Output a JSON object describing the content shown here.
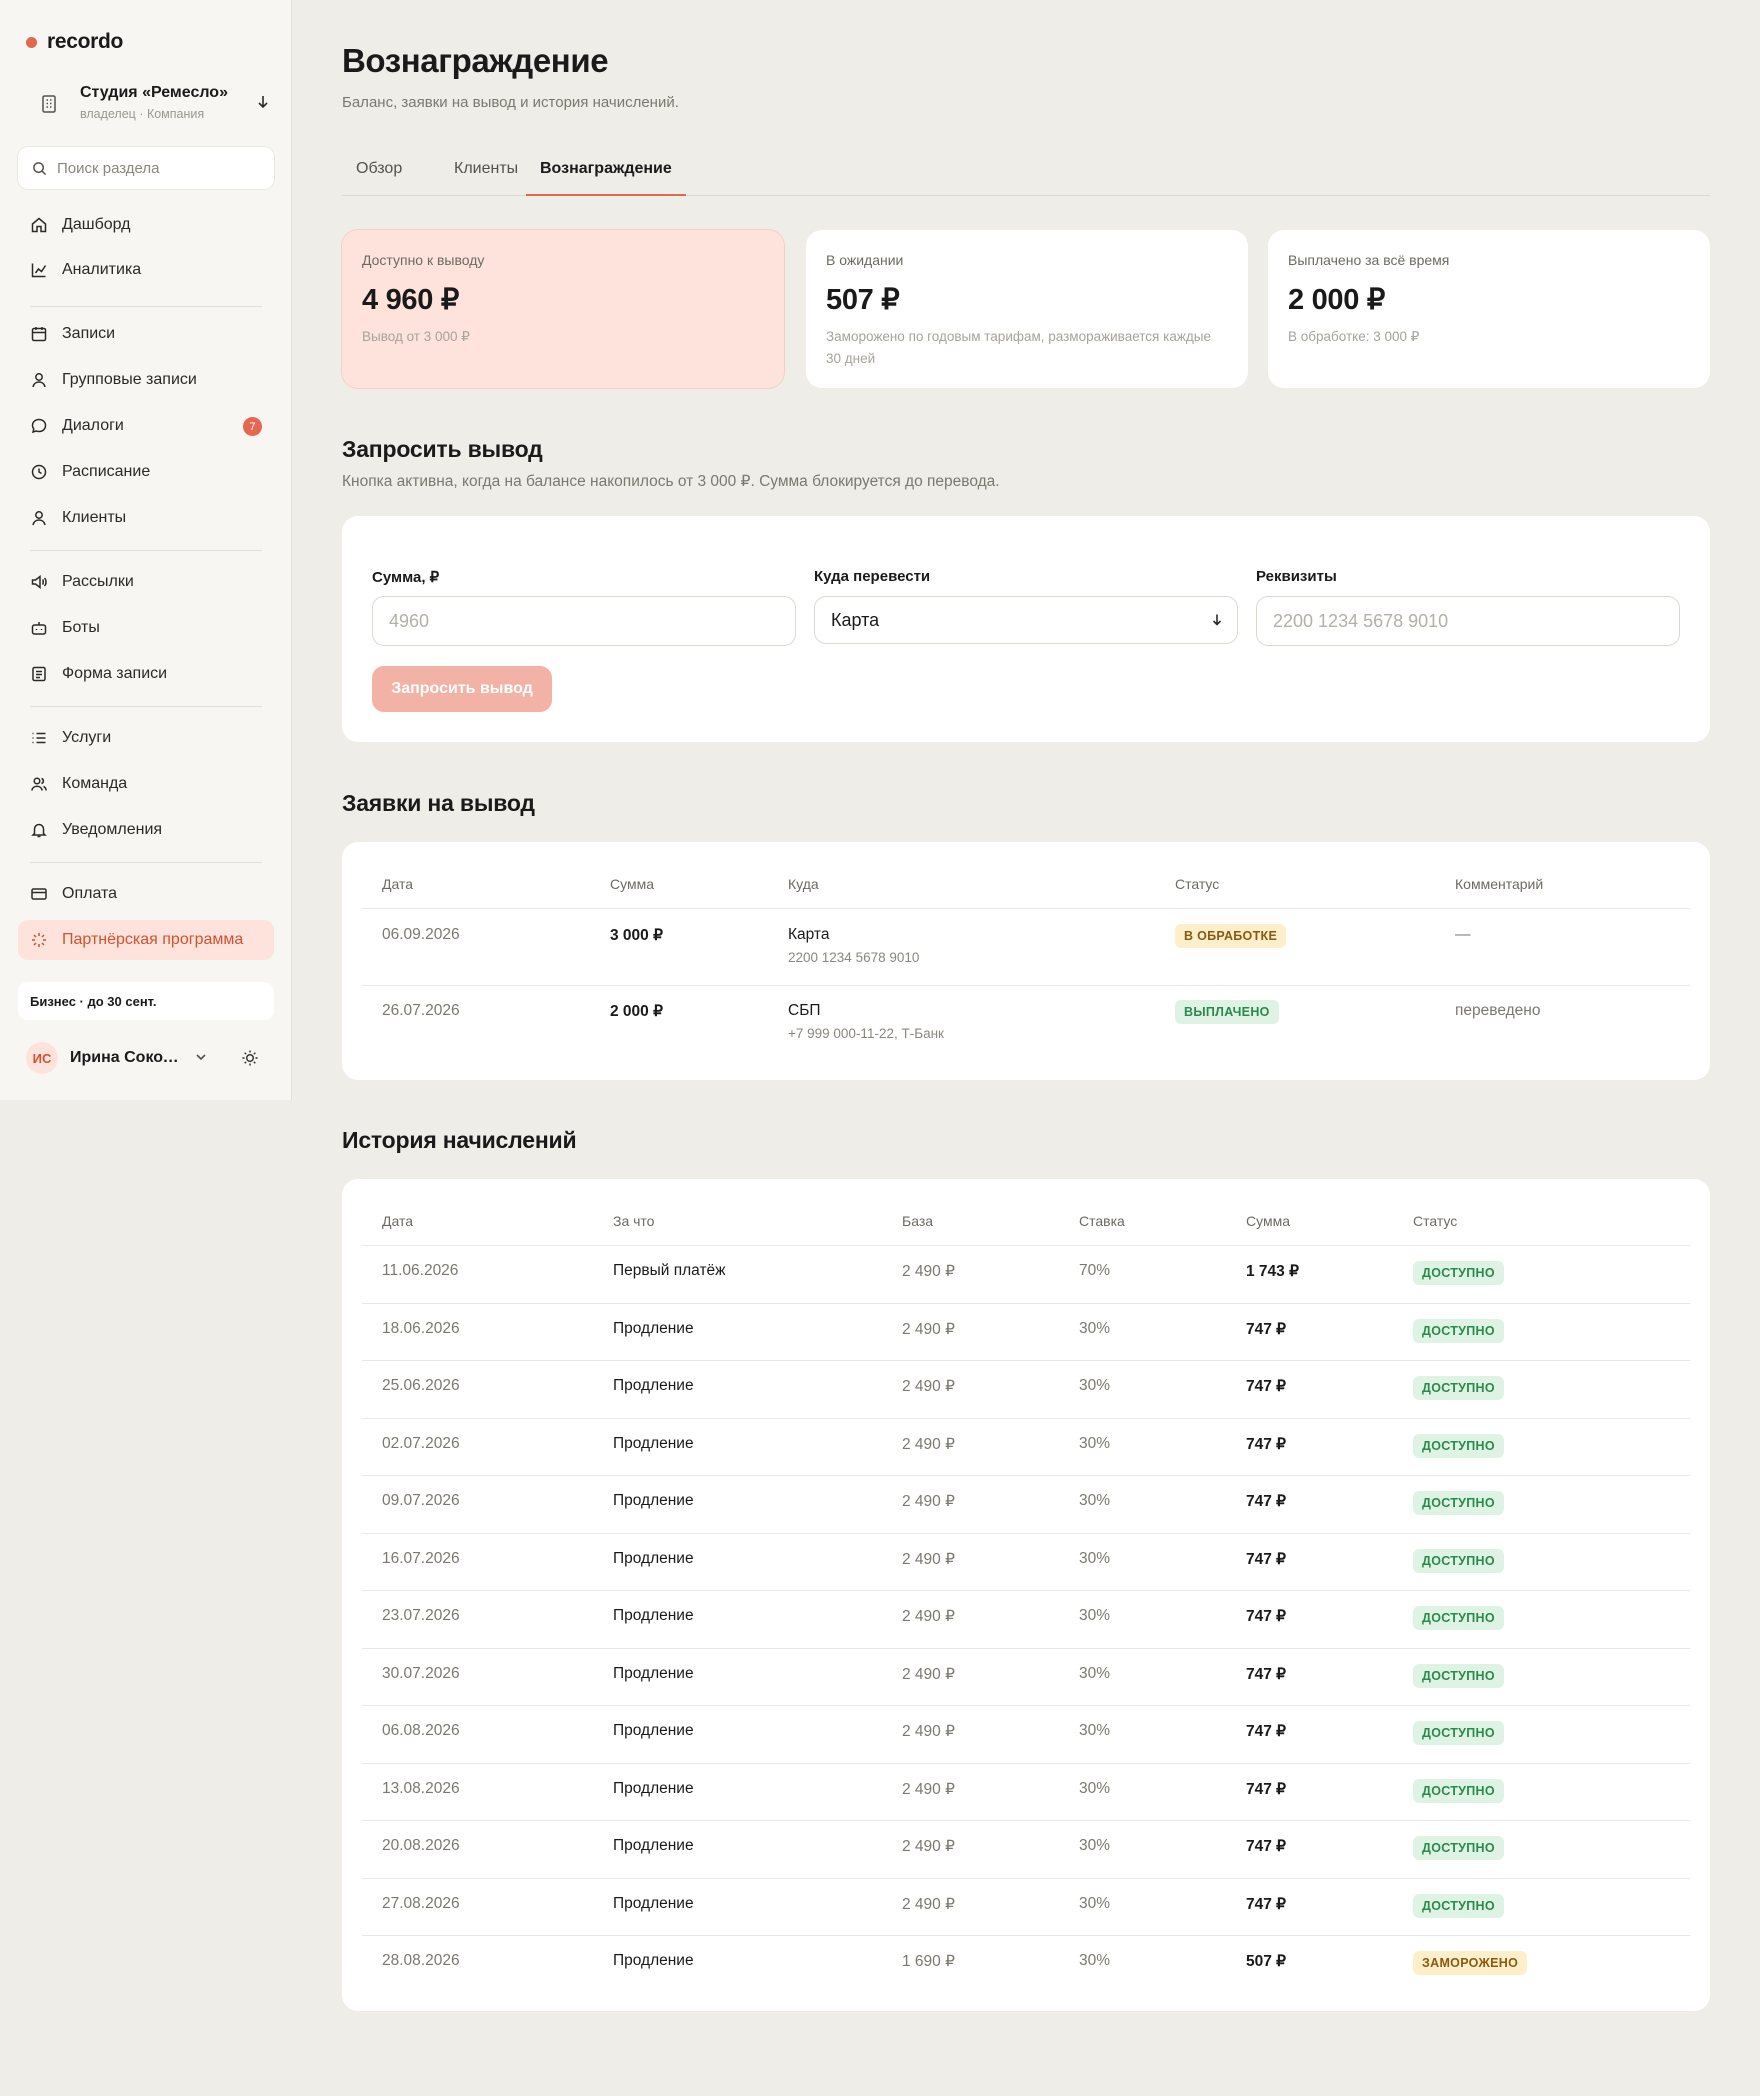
{
  "app": {
    "logo": "recordo",
    "accent": "#e4674f"
  },
  "workspace": {
    "name": "Студия «Ремесло»",
    "role": "владелец · Компания"
  },
  "search": {
    "placeholder": "Поиск раздела"
  },
  "nav": [
    {
      "label": "Дашборд",
      "icon": "home-icon"
    },
    {
      "label": "Аналитика",
      "icon": "chart-icon"
    },
    {
      "label": "Записи",
      "icon": "calendar-icon"
    },
    {
      "label": "Групповые записи",
      "icon": "user-icon"
    },
    {
      "label": "Диалоги",
      "icon": "chat-icon",
      "badge": "7"
    },
    {
      "label": "Расписание",
      "icon": "clock-icon"
    },
    {
      "label": "Клиенты",
      "icon": "user-icon"
    },
    {
      "label": "Рассылки",
      "icon": "megaphone-icon"
    },
    {
      "label": "Боты",
      "icon": "bot-icon"
    },
    {
      "label": "Форма записи",
      "icon": "form-icon"
    },
    {
      "label": "Услуги",
      "icon": "list-icon"
    },
    {
      "label": "Команда",
      "icon": "team-icon"
    },
    {
      "label": "Уведомления",
      "icon": "bell-icon"
    },
    {
      "label": "Оплата",
      "icon": "card-icon"
    },
    {
      "label": "Партнёрская программа",
      "icon": "sparkle-icon"
    }
  ],
  "plan": {
    "label": "Бизнес · до 30 сент."
  },
  "user": {
    "initials": "ИС",
    "name": "Ирина Соколова"
  },
  "page": {
    "title": "Вознаграждение",
    "subtitle": "Баланс, заявки на вывод и история начислений."
  },
  "tabs": [
    "Обзор",
    "Клиенты",
    "Вознаграждение"
  ],
  "kpis": [
    {
      "label": "Доступно к выводу",
      "value": "4 960 ₽",
      "note": "Вывод от 3 000 ₽"
    },
    {
      "label": "В ожидании",
      "value": "507 ₽",
      "note": "Заморожено по годовым тарифам, размораживается каждые 30 дней"
    },
    {
      "label": "Выплачено за всё время",
      "value": "2 000 ₽",
      "note": "В обработке: 3 000 ₽"
    }
  ],
  "withdraw": {
    "title": "Запросить вывод",
    "desc": "Кнопка активна, когда на балансе накопилось от 3 000 ₽. Сумма блокируется до перевода.",
    "amount_label": "Сумма, ₽",
    "amount_placeholder": "4960",
    "dest_label": "Куда перевести",
    "dest_value": "Карта",
    "req_label": "Реквизиты",
    "req_placeholder": "2200 1234 5678 9010",
    "button": "Запросить вывод"
  },
  "requests": {
    "title": "Заявки на вывод",
    "headers": [
      "Дата",
      "Сумма",
      "Куда",
      "Статус",
      "Комментарий"
    ],
    "rows": [
      {
        "date": "06.09.2026",
        "amount": "3 000 ₽",
        "dest": "Карта",
        "dest_detail": "2200 1234 5678 9010",
        "status": "В ОБРАБОТКЕ",
        "comment": "—"
      },
      {
        "date": "26.07.2026",
        "amount": "2 000 ₽",
        "dest": "СБП",
        "dest_detail": "+7 999 000-11-22, Т-Банк",
        "status": "ВЫПЛАЧЕНО",
        "comment": "переведено"
      }
    ]
  },
  "history": {
    "title": "История начислений",
    "headers": [
      "Дата",
      "За что",
      "База",
      "Ставка",
      "Сумма",
      "Статус"
    ],
    "rows": [
      {
        "date": "11.06.2026",
        "reason": "Первый платёж",
        "base": "2 490 ₽",
        "rate": "70%",
        "sum": "1 743 ₽",
        "status": "ДОСТУПНО"
      },
      {
        "date": "18.06.2026",
        "reason": "Продление",
        "base": "2 490 ₽",
        "rate": "30%",
        "sum": "747 ₽",
        "status": "ДОСТУПНО"
      },
      {
        "date": "25.06.2026",
        "reason": "Продление",
        "base": "2 490 ₽",
        "rate": "30%",
        "sum": "747 ₽",
        "status": "ДОСТУПНО"
      },
      {
        "date": "02.07.2026",
        "reason": "Продление",
        "base": "2 490 ₽",
        "rate": "30%",
        "sum": "747 ₽",
        "status": "ДОСТУПНО"
      },
      {
        "date": "09.07.2026",
        "reason": "Продление",
        "base": "2 490 ₽",
        "rate": "30%",
        "sum": "747 ₽",
        "status": "ДОСТУПНО"
      },
      {
        "date": "16.07.2026",
        "reason": "Продление",
        "base": "2 490 ₽",
        "rate": "30%",
        "sum": "747 ₽",
        "status": "ДОСТУПНО"
      },
      {
        "date": "23.07.2026",
        "reason": "Продление",
        "base": "2 490 ₽",
        "rate": "30%",
        "sum": "747 ₽",
        "status": "ДОСТУПНО"
      },
      {
        "date": "30.07.2026",
        "reason": "Продление",
        "base": "2 490 ₽",
        "rate": "30%",
        "sum": "747 ₽",
        "status": "ДОСТУПНО"
      },
      {
        "date": "06.08.2026",
        "reason": "Продление",
        "base": "2 490 ₽",
        "rate": "30%",
        "sum": "747 ₽",
        "status": "ДОСТУПНО"
      },
      {
        "date": "13.08.2026",
        "reason": "Продление",
        "base": "2 490 ₽",
        "rate": "30%",
        "sum": "747 ₽",
        "status": "ДОСТУПНО"
      },
      {
        "date": "20.08.2026",
        "reason": "Продление",
        "base": "2 490 ₽",
        "rate": "30%",
        "sum": "747 ₽",
        "status": "ДОСТУПНО"
      },
      {
        "date": "27.08.2026",
        "reason": "Продление",
        "base": "2 490 ₽",
        "rate": "30%",
        "sum": "747 ₽",
        "status": "ДОСТУПНО"
      },
      {
        "date": "28.08.2026",
        "reason": "Продление",
        "base": "1 690 ₽",
        "rate": "30%",
        "sum": "507 ₽",
        "status": "ЗАМОРОЖЕНО"
      }
    ]
  }
}
